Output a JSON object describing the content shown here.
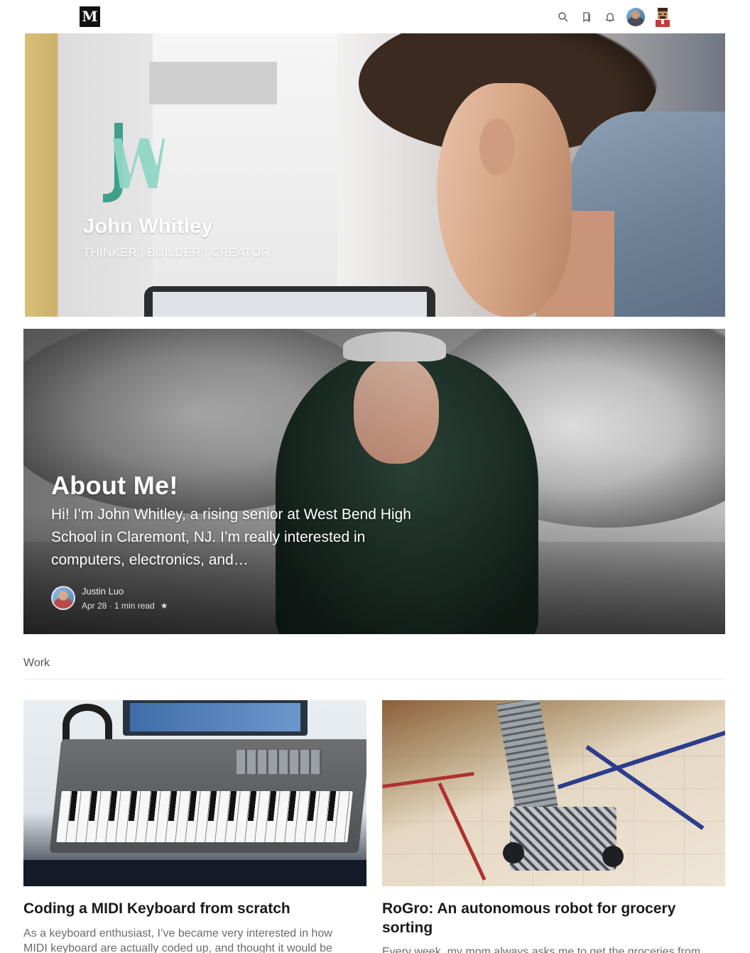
{
  "header": {
    "logo_letter": "M",
    "icons": [
      "search-icon",
      "bookmarks-icon",
      "notifications-icon",
      "user-avatar",
      "profile-emoji-avatar"
    ]
  },
  "hero": {
    "monogram": "JW",
    "title": "John Whitley",
    "subtitle": "THINKER | BUILDER | CREATOR",
    "monogram_colors": {
      "j": "#3fa08a",
      "w": "#8fd6c4"
    }
  },
  "featured_story": {
    "title": "About Me!",
    "excerpt": "Hi! I’m John Whitley, a rising senior at West Bend High School in Claremont, NJ. I’m really interested in computers, electronics, and…",
    "author": "Justin Luo",
    "date": "Apr 28",
    "read_time": "1 min read",
    "star": "★"
  },
  "section": {
    "label": "Work"
  },
  "posts": [
    {
      "title": "Coding a MIDI Keyboard from scratch",
      "excerpt": "As a keyboard enthusiast, I’ve became very interested in how MIDI keyboard are actually coded up, and thought it would be"
    },
    {
      "title": "RoGro: An autonomous robot for grocery sorting",
      "excerpt": "Every week, my mom always asks me to get the groceries from"
    }
  ]
}
